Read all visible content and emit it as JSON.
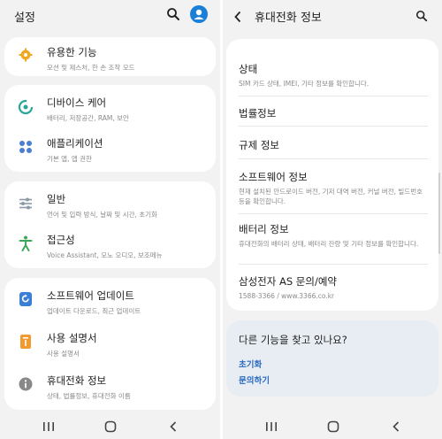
{
  "left": {
    "title": "설정",
    "cards": [
      {
        "items": [
          {
            "icon": "gear-icon",
            "title": "유용한 기능",
            "subtitle": "모션 및 제스처, 한 손 조작 모드"
          }
        ]
      },
      {
        "items": [
          {
            "icon": "device-care-icon",
            "title": "디바이스 케어",
            "subtitle": "배터리, 저장공간, RAM, 보안"
          },
          {
            "icon": "apps-icon",
            "title": "애플리케이션",
            "subtitle": "기본 앱, 앱 권한"
          }
        ]
      },
      {
        "items": [
          {
            "icon": "sliders-icon",
            "title": "일반",
            "subtitle": "언어 및 입력 방식, 날짜 및 시간, 초기화"
          },
          {
            "icon": "accessibility-icon",
            "title": "접근성",
            "subtitle": "Voice Assistant, 모노 오디오, 보조메뉴"
          }
        ]
      },
      {
        "items": [
          {
            "icon": "software-update-icon",
            "title": "소프트웨어 업데이트",
            "subtitle": "업데이트 다운로드, 최근 업데이트"
          },
          {
            "icon": "manual-icon",
            "title": "사용 설명서",
            "subtitle": "사용 설명서"
          },
          {
            "icon": "info-icon",
            "title": "휴대전화 정보",
            "subtitle": "상태, 법률정보, 휴대전화 이름"
          }
        ]
      }
    ]
  },
  "right": {
    "title": "휴대전화 정보",
    "items": [
      {
        "title": "상태",
        "subtitle": "SIM 카드 상태, IMEI, 기타 정보를 확인합니다."
      },
      {
        "title": "법률정보",
        "subtitle": ""
      },
      {
        "title": "규제 정보",
        "subtitle": ""
      },
      {
        "title": "소프트웨어 정보",
        "subtitle": "현재 설치된 안드로이드 버전, 기저 대역 버전, 커널 버전, 빌드번호 등을 확인합니다."
      },
      {
        "title": "배터리 정보",
        "subtitle": "휴대전화의 배터리 상태, 배터리 잔량 및 기타 정보를 확인합니다."
      },
      {
        "title": "삼성전자 AS 문의/예약",
        "subtitle": "1588-3366 / www.3366.co.kr"
      }
    ],
    "help": {
      "title": "다른 기능을 찾고 있나요?",
      "links": [
        "초기화",
        "문의하기"
      ]
    }
  },
  "colors": {
    "accent": "#2a6ac0",
    "profile": "#1a7fd6",
    "gear": "#f0a820",
    "device_care": "#2aa59a",
    "apps": "#4a7fd0",
    "general": "#8a9aa8",
    "accessibility": "#3aaa5a",
    "update": "#3a7fd6",
    "manual": "#f09a30",
    "info": "#888888"
  }
}
